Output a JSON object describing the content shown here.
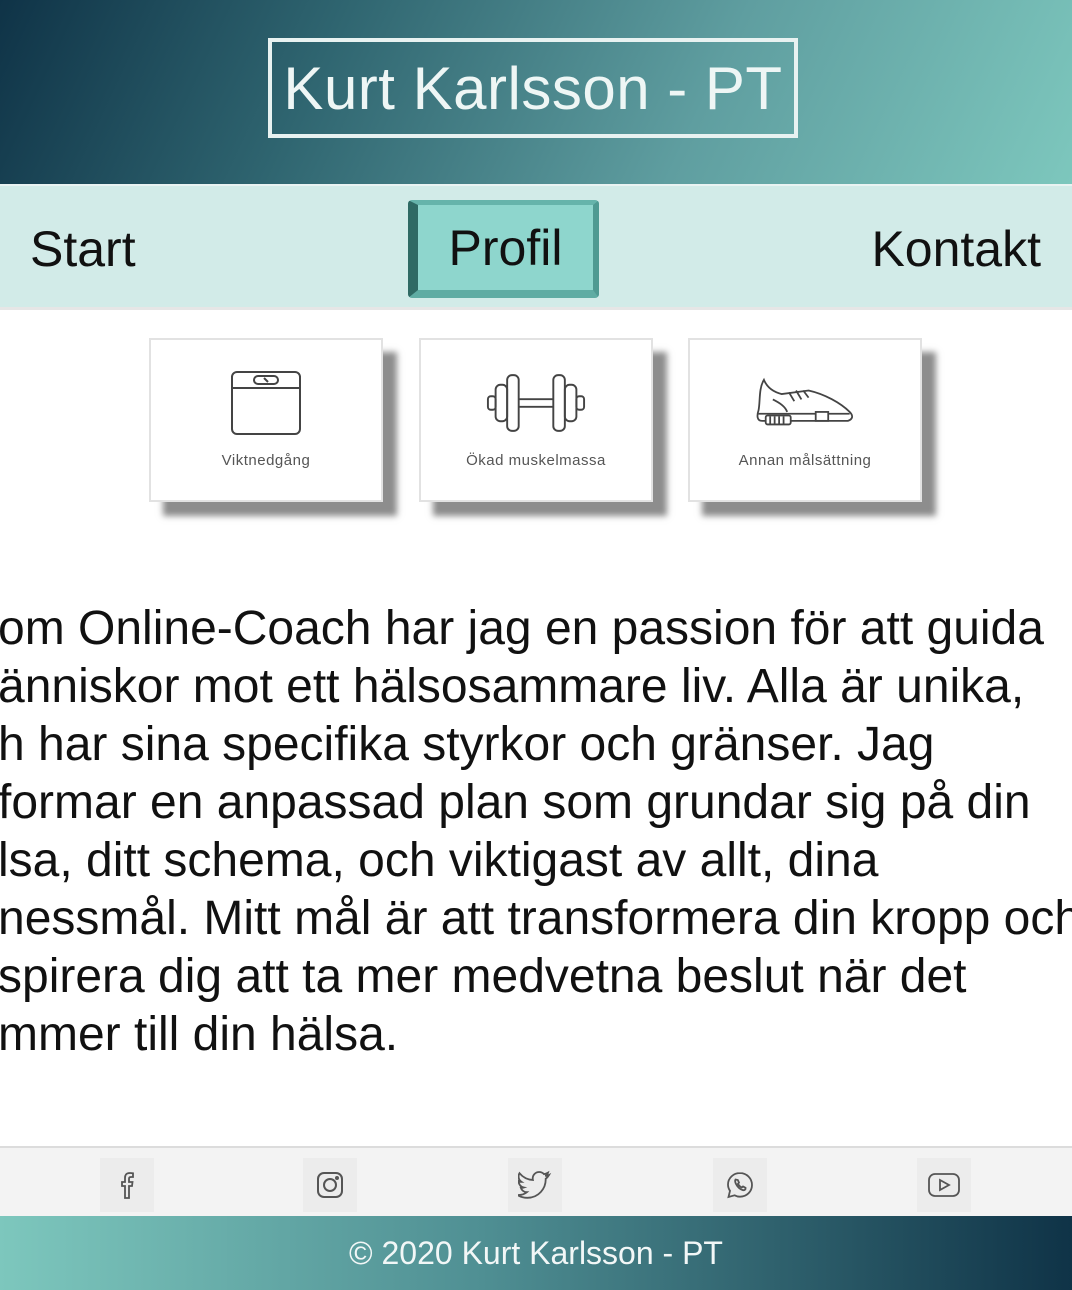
{
  "header": {
    "title": "Kurt Karlsson - PT"
  },
  "nav": {
    "start": "Start",
    "profil": "Profil",
    "kontakt": "Kontakt",
    "active": "Profil"
  },
  "cards": [
    {
      "label": "Viktnedgång",
      "icon": "scale-icon"
    },
    {
      "label": "Ökad muskelmassa",
      "icon": "dumbbell-icon"
    },
    {
      "label": "Annan målsättning",
      "icon": "sneaker-icon"
    }
  ],
  "paragraph_lines": [
    "om Online-Coach har jag en passion för att guida",
    "änniskor mot ett hälsosammare liv. Alla är unika,",
    "h har sina specifika styrkor och gränser. Jag",
    "formar en anpassad plan som grundar sig på din",
    "lsa, ditt schema, och viktigast av allt, dina",
    "nessmål. Mitt mål är att transformera din kropp och",
    "spirera dig att ta mer medvetna beslut när det",
    "mmer till din hälsa."
  ],
  "social": [
    "facebook-icon",
    "instagram-icon",
    "twitter-icon",
    "whatsapp-icon",
    "youtube-icon"
  ],
  "footer": {
    "text": "© 2020 Kurt Karlsson - PT"
  },
  "colors": {
    "accent": "#8ed6cd",
    "nav_bg": "#d2ebe8",
    "dark": "#0f3347"
  }
}
